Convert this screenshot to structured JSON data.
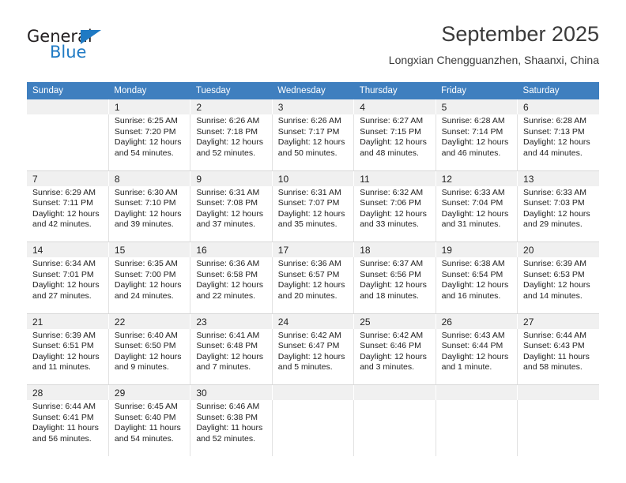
{
  "brand": {
    "name_part1": "General",
    "name_part2": "Blue",
    "triangle_color": "#1f7ac4",
    "text_color": "#231f20"
  },
  "header": {
    "title": "September 2025",
    "subtitle": "Longxian Chengguanzhen, Shaanxi, China"
  },
  "theme": {
    "header_row_bg": "#3f7fbf",
    "header_row_text": "#ffffff",
    "date_strip_bg": "#f0f0f0",
    "cell_bg": "#ffffff",
    "cell_text": "#222222",
    "grid_line": "#e2e2e2"
  },
  "weekdays": [
    "Sunday",
    "Monday",
    "Tuesday",
    "Wednesday",
    "Thursday",
    "Friday",
    "Saturday"
  ],
  "weeks": [
    {
      "numbers": [
        "",
        "1",
        "2",
        "3",
        "4",
        "5",
        "6"
      ],
      "cells": [
        {
          "sunrise": "",
          "sunset": "",
          "daylight1": "",
          "daylight2": ""
        },
        {
          "sunrise": "Sunrise: 6:25 AM",
          "sunset": "Sunset: 7:20 PM",
          "daylight1": "Daylight: 12 hours",
          "daylight2": "and 54 minutes."
        },
        {
          "sunrise": "Sunrise: 6:26 AM",
          "sunset": "Sunset: 7:18 PM",
          "daylight1": "Daylight: 12 hours",
          "daylight2": "and 52 minutes."
        },
        {
          "sunrise": "Sunrise: 6:26 AM",
          "sunset": "Sunset: 7:17 PM",
          "daylight1": "Daylight: 12 hours",
          "daylight2": "and 50 minutes."
        },
        {
          "sunrise": "Sunrise: 6:27 AM",
          "sunset": "Sunset: 7:15 PM",
          "daylight1": "Daylight: 12 hours",
          "daylight2": "and 48 minutes."
        },
        {
          "sunrise": "Sunrise: 6:28 AM",
          "sunset": "Sunset: 7:14 PM",
          "daylight1": "Daylight: 12 hours",
          "daylight2": "and 46 minutes."
        },
        {
          "sunrise": "Sunrise: 6:28 AM",
          "sunset": "Sunset: 7:13 PM",
          "daylight1": "Daylight: 12 hours",
          "daylight2": "and 44 minutes."
        }
      ]
    },
    {
      "numbers": [
        "7",
        "8",
        "9",
        "10",
        "11",
        "12",
        "13"
      ],
      "cells": [
        {
          "sunrise": "Sunrise: 6:29 AM",
          "sunset": "Sunset: 7:11 PM",
          "daylight1": "Daylight: 12 hours",
          "daylight2": "and 42 minutes."
        },
        {
          "sunrise": "Sunrise: 6:30 AM",
          "sunset": "Sunset: 7:10 PM",
          "daylight1": "Daylight: 12 hours",
          "daylight2": "and 39 minutes."
        },
        {
          "sunrise": "Sunrise: 6:31 AM",
          "sunset": "Sunset: 7:08 PM",
          "daylight1": "Daylight: 12 hours",
          "daylight2": "and 37 minutes."
        },
        {
          "sunrise": "Sunrise: 6:31 AM",
          "sunset": "Sunset: 7:07 PM",
          "daylight1": "Daylight: 12 hours",
          "daylight2": "and 35 minutes."
        },
        {
          "sunrise": "Sunrise: 6:32 AM",
          "sunset": "Sunset: 7:06 PM",
          "daylight1": "Daylight: 12 hours",
          "daylight2": "and 33 minutes."
        },
        {
          "sunrise": "Sunrise: 6:33 AM",
          "sunset": "Sunset: 7:04 PM",
          "daylight1": "Daylight: 12 hours",
          "daylight2": "and 31 minutes."
        },
        {
          "sunrise": "Sunrise: 6:33 AM",
          "sunset": "Sunset: 7:03 PM",
          "daylight1": "Daylight: 12 hours",
          "daylight2": "and 29 minutes."
        }
      ]
    },
    {
      "numbers": [
        "14",
        "15",
        "16",
        "17",
        "18",
        "19",
        "20"
      ],
      "cells": [
        {
          "sunrise": "Sunrise: 6:34 AM",
          "sunset": "Sunset: 7:01 PM",
          "daylight1": "Daylight: 12 hours",
          "daylight2": "and 27 minutes."
        },
        {
          "sunrise": "Sunrise: 6:35 AM",
          "sunset": "Sunset: 7:00 PM",
          "daylight1": "Daylight: 12 hours",
          "daylight2": "and 24 minutes."
        },
        {
          "sunrise": "Sunrise: 6:36 AM",
          "sunset": "Sunset: 6:58 PM",
          "daylight1": "Daylight: 12 hours",
          "daylight2": "and 22 minutes."
        },
        {
          "sunrise": "Sunrise: 6:36 AM",
          "sunset": "Sunset: 6:57 PM",
          "daylight1": "Daylight: 12 hours",
          "daylight2": "and 20 minutes."
        },
        {
          "sunrise": "Sunrise: 6:37 AM",
          "sunset": "Sunset: 6:56 PM",
          "daylight1": "Daylight: 12 hours",
          "daylight2": "and 18 minutes."
        },
        {
          "sunrise": "Sunrise: 6:38 AM",
          "sunset": "Sunset: 6:54 PM",
          "daylight1": "Daylight: 12 hours",
          "daylight2": "and 16 minutes."
        },
        {
          "sunrise": "Sunrise: 6:39 AM",
          "sunset": "Sunset: 6:53 PM",
          "daylight1": "Daylight: 12 hours",
          "daylight2": "and 14 minutes."
        }
      ]
    },
    {
      "numbers": [
        "21",
        "22",
        "23",
        "24",
        "25",
        "26",
        "27"
      ],
      "cells": [
        {
          "sunrise": "Sunrise: 6:39 AM",
          "sunset": "Sunset: 6:51 PM",
          "daylight1": "Daylight: 12 hours",
          "daylight2": "and 11 minutes."
        },
        {
          "sunrise": "Sunrise: 6:40 AM",
          "sunset": "Sunset: 6:50 PM",
          "daylight1": "Daylight: 12 hours",
          "daylight2": "and 9 minutes."
        },
        {
          "sunrise": "Sunrise: 6:41 AM",
          "sunset": "Sunset: 6:48 PM",
          "daylight1": "Daylight: 12 hours",
          "daylight2": "and 7 minutes."
        },
        {
          "sunrise": "Sunrise: 6:42 AM",
          "sunset": "Sunset: 6:47 PM",
          "daylight1": "Daylight: 12 hours",
          "daylight2": "and 5 minutes."
        },
        {
          "sunrise": "Sunrise: 6:42 AM",
          "sunset": "Sunset: 6:46 PM",
          "daylight1": "Daylight: 12 hours",
          "daylight2": "and 3 minutes."
        },
        {
          "sunrise": "Sunrise: 6:43 AM",
          "sunset": "Sunset: 6:44 PM",
          "daylight1": "Daylight: 12 hours",
          "daylight2": "and 1 minute."
        },
        {
          "sunrise": "Sunrise: 6:44 AM",
          "sunset": "Sunset: 6:43 PM",
          "daylight1": "Daylight: 11 hours",
          "daylight2": "and 58 minutes."
        }
      ]
    },
    {
      "numbers": [
        "28",
        "29",
        "30",
        "",
        "",
        "",
        ""
      ],
      "cells": [
        {
          "sunrise": "Sunrise: 6:44 AM",
          "sunset": "Sunset: 6:41 PM",
          "daylight1": "Daylight: 11 hours",
          "daylight2": "and 56 minutes."
        },
        {
          "sunrise": "Sunrise: 6:45 AM",
          "sunset": "Sunset: 6:40 PM",
          "daylight1": "Daylight: 11 hours",
          "daylight2": "and 54 minutes."
        },
        {
          "sunrise": "Sunrise: 6:46 AM",
          "sunset": "Sunset: 6:38 PM",
          "daylight1": "Daylight: 11 hours",
          "daylight2": "and 52 minutes."
        },
        {
          "sunrise": "",
          "sunset": "",
          "daylight1": "",
          "daylight2": ""
        },
        {
          "sunrise": "",
          "sunset": "",
          "daylight1": "",
          "daylight2": ""
        },
        {
          "sunrise": "",
          "sunset": "",
          "daylight1": "",
          "daylight2": ""
        },
        {
          "sunrise": "",
          "sunset": "",
          "daylight1": "",
          "daylight2": ""
        }
      ]
    }
  ]
}
